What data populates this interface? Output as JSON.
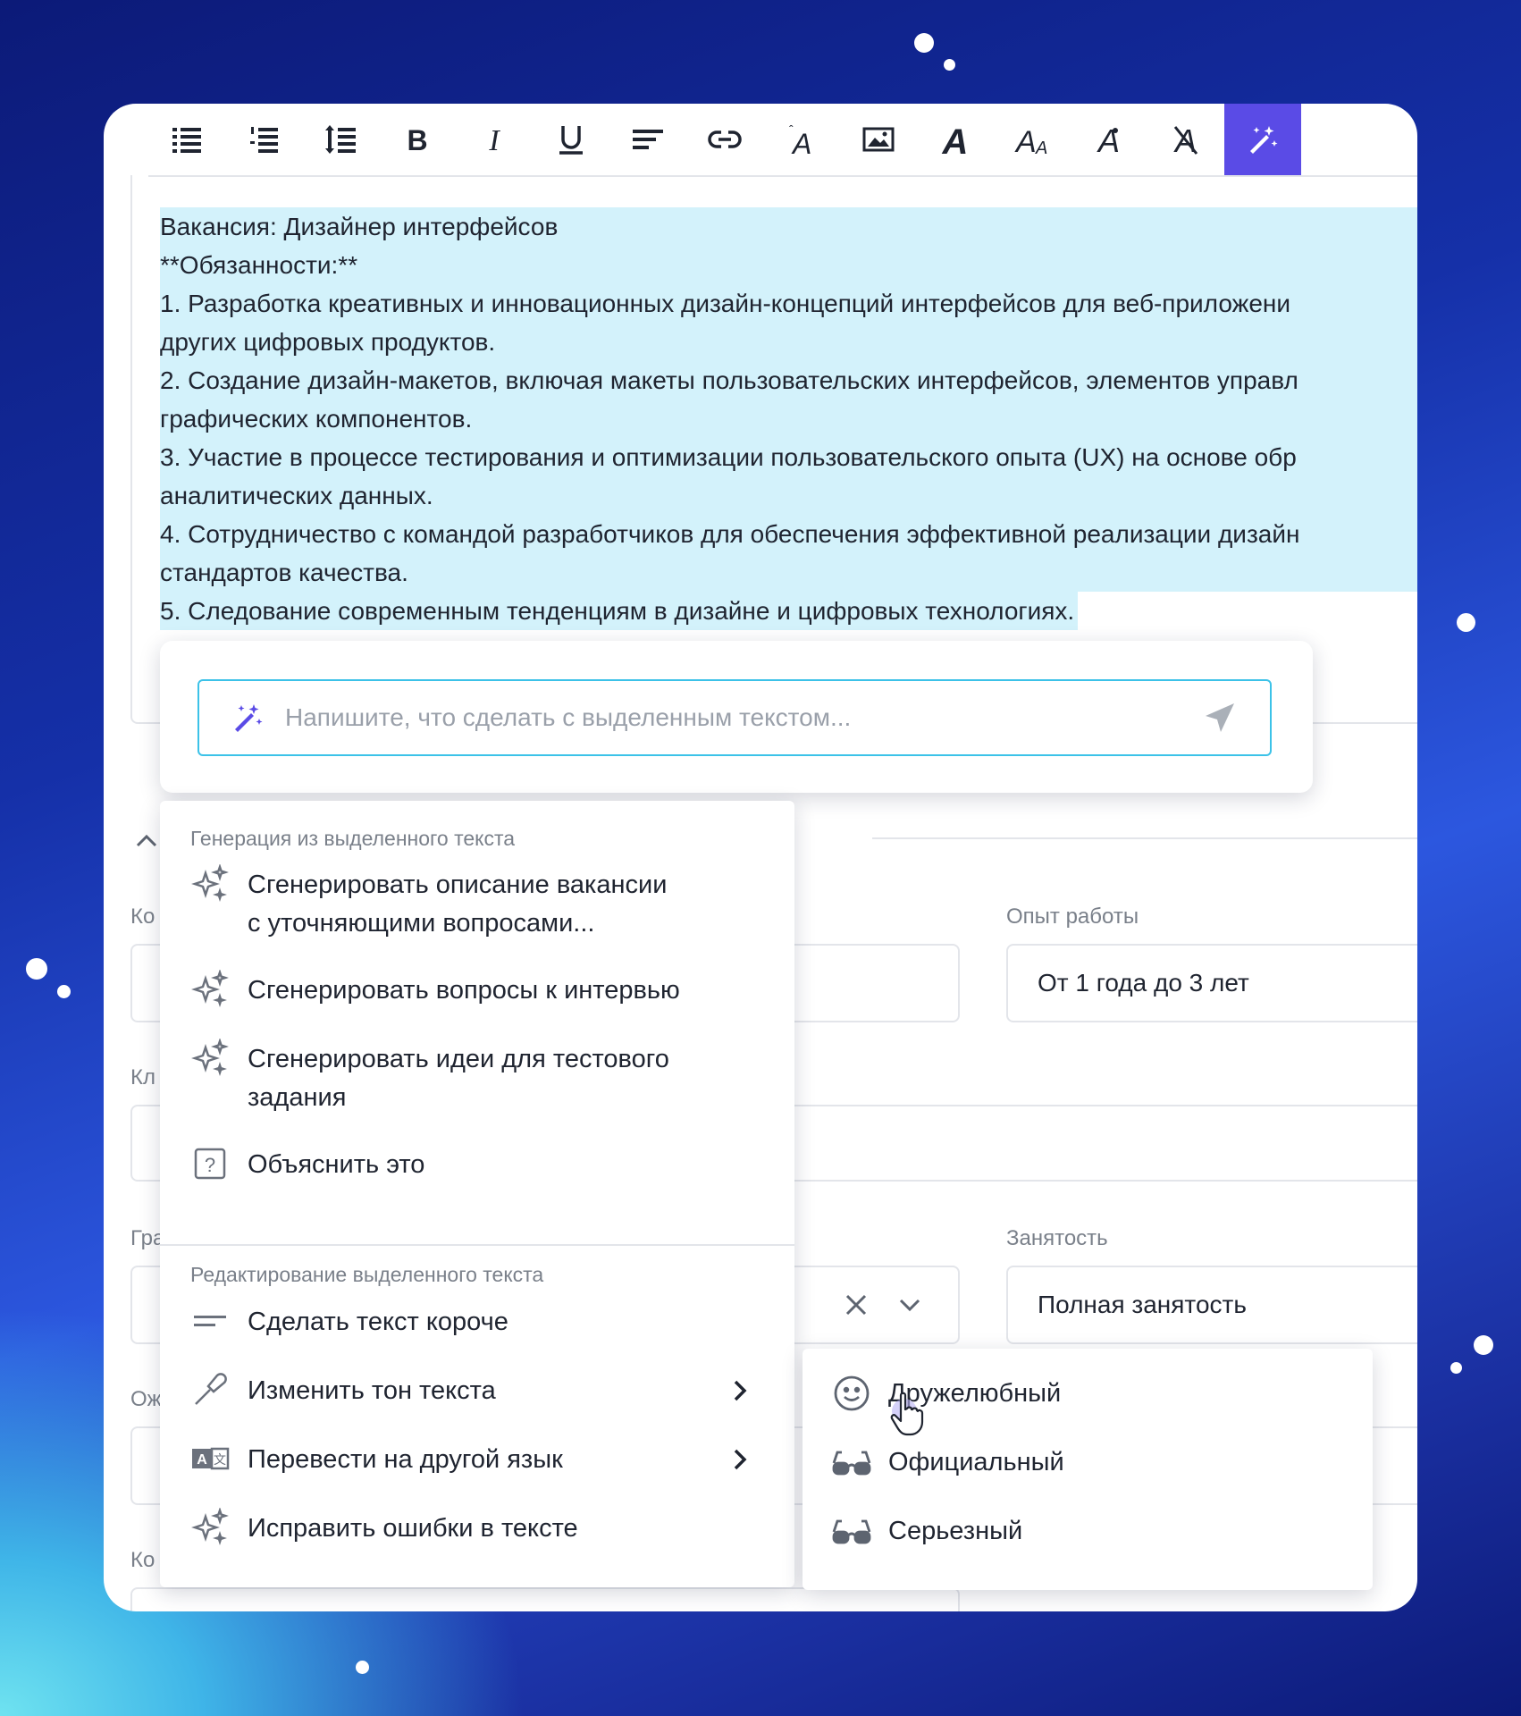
{
  "toolbar": {
    "buttons": [
      "bulleted-list",
      "numbered-list",
      "line-spacing",
      "bold",
      "italic",
      "underline",
      "align",
      "link",
      "text-size",
      "image",
      "font",
      "font-size",
      "font-style",
      "clear-format",
      "ai-magic"
    ],
    "active": "ai-magic",
    "accent_color": "#5a4be6"
  },
  "editor": {
    "lines": [
      "Вакансия: Дизайнер интерфейсов",
      "**Обязанности:**",
      "1. Разработка креативных и инновационных дизайн-концепций интерфейсов для веб-приложени",
      "других цифровых продуктов.",
      "2. Создание дизайн-макетов, включая макеты пользовательских интерфейсов, элементов управл",
      "графических компонентов.",
      "3. Участие в процессе тестирования и оптимизации пользовательского опыта (UX) на основе обр",
      "аналитических данных.",
      "4. Сотрудничество с командой разработчиков для обеспечения эффективной реализации дизайн",
      "стандартов качества."
    ],
    "last_line": "5. Следование современным тенденциям в дизайне и цифровых технологиях.",
    "highlight_color": "#d3f2fb"
  },
  "ai_prompt": {
    "placeholder": "Напишите, что сделать с выделенным текстом...",
    "border_color": "#3cc2e8"
  },
  "form": {
    "experience_label": "Опыт работы",
    "experience_value": "От 1 года до 3 лет",
    "employment_label": "Занятость",
    "employment_value": "Полная занятость",
    "clipped_labels": [
      "Ко",
      "Кл",
      "Гра",
      "Ож",
      "Ко"
    ]
  },
  "menu": {
    "generate_header": "Генерация из выделенного текста",
    "generate_items": [
      {
        "label_line1": "Сгенерировать описание вакансии",
        "label_line2": "с уточняющими вопросами...",
        "icon": "sparkle-icon"
      },
      {
        "label_line1": "Сгенерировать вопросы к интервью",
        "icon": "sparkle-icon"
      },
      {
        "label_line1": "Сгенерировать идеи для тестового",
        "label_line2": "задания",
        "icon": "sparkle-icon"
      },
      {
        "label_line1": "Объяснить это",
        "icon": "question-icon"
      }
    ],
    "edit_header": "Редактирование выделенного текста",
    "edit_items": [
      {
        "label": "Сделать текст короче",
        "icon": "shorten-icon"
      },
      {
        "label": "Изменить тон текста",
        "icon": "brush-icon",
        "has_submenu": true
      },
      {
        "label": "Перевести на другой язык",
        "icon": "translate-icon",
        "has_submenu": true
      },
      {
        "label": "Исправить ошибки в тексте",
        "icon": "sparkle-icon"
      }
    ]
  },
  "tone_submenu": {
    "items": [
      {
        "label": "Дружелюбный",
        "icon": "smile-icon"
      },
      {
        "label": "Официальный",
        "icon": "glasses-icon"
      },
      {
        "label": "Серьезный",
        "icon": "glasses-icon"
      }
    ]
  }
}
